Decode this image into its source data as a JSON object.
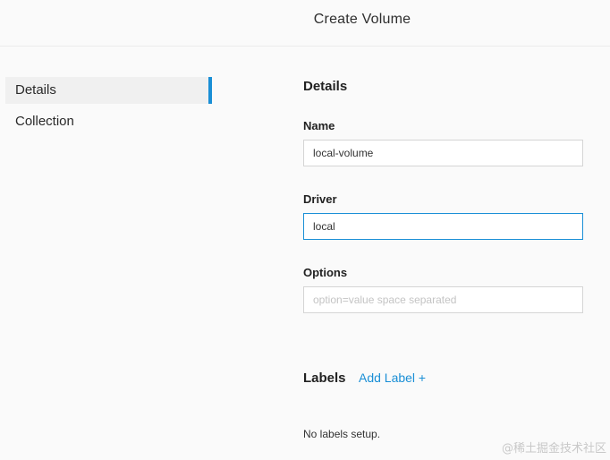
{
  "header": {
    "title": "Create Volume"
  },
  "sidebar": {
    "items": [
      {
        "label": "Details",
        "active": true
      },
      {
        "label": "Collection",
        "active": false
      }
    ]
  },
  "form": {
    "section_title": "Details",
    "name": {
      "label": "Name",
      "value": "local-volume",
      "placeholder": ""
    },
    "driver": {
      "label": "Driver",
      "value": "local",
      "placeholder": ""
    },
    "options": {
      "label": "Options",
      "value": "",
      "placeholder": "option=value space separated"
    }
  },
  "labels": {
    "title": "Labels",
    "add_label": "Add Label +",
    "empty_message": "No labels setup."
  },
  "watermark": "@稀土掘金技术社区",
  "colors": {
    "accent": "#1a8fd6",
    "background": "#fafafa"
  }
}
